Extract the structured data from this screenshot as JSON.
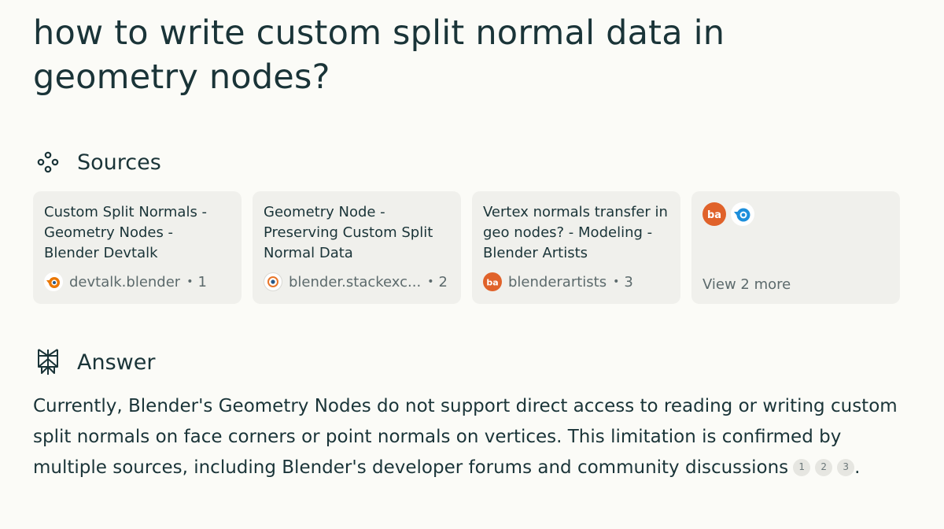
{
  "question": "how to write custom split normal data in geometry nodes?",
  "sources_section": {
    "label": "Sources",
    "icon": "sources-icon"
  },
  "sources": [
    {
      "title": "Custom Split Normals - Geometry Nodes - Blender Devtalk",
      "site": "devtalk.blender",
      "index": "1",
      "favicon": "blender-logo-icon"
    },
    {
      "title": "Geometry Node - Preserving Custom Split Normal Data",
      "site": "blender.stackexc...",
      "index": "2",
      "favicon": "stackexchange-blender-icon"
    },
    {
      "title": "Vertex normals transfer in geo nodes? - Modeling - Blender Artists",
      "site": "blenderartists",
      "index": "3",
      "favicon": "blenderartists-icon"
    }
  ],
  "more_sources": {
    "label": "View 2 more",
    "favicons": [
      "blenderartists-icon",
      "blender-blue-icon"
    ]
  },
  "answer_section": {
    "label": "Answer",
    "icon": "perplexity-icon"
  },
  "answer": {
    "text": "Currently, Blender's Geometry Nodes do not support direct access to reading or writing custom split normals on face corners or point normals on vertices. This limitation is confirmed by multiple sources, including Blender's developer forums and community discussions",
    "citations": [
      "1",
      "2",
      "3"
    ],
    "trailing": "."
  },
  "colors": {
    "background": "#fbfbf7",
    "card": "#f0f0ec",
    "text": "#1a3438",
    "muted": "#5c6a6c"
  }
}
